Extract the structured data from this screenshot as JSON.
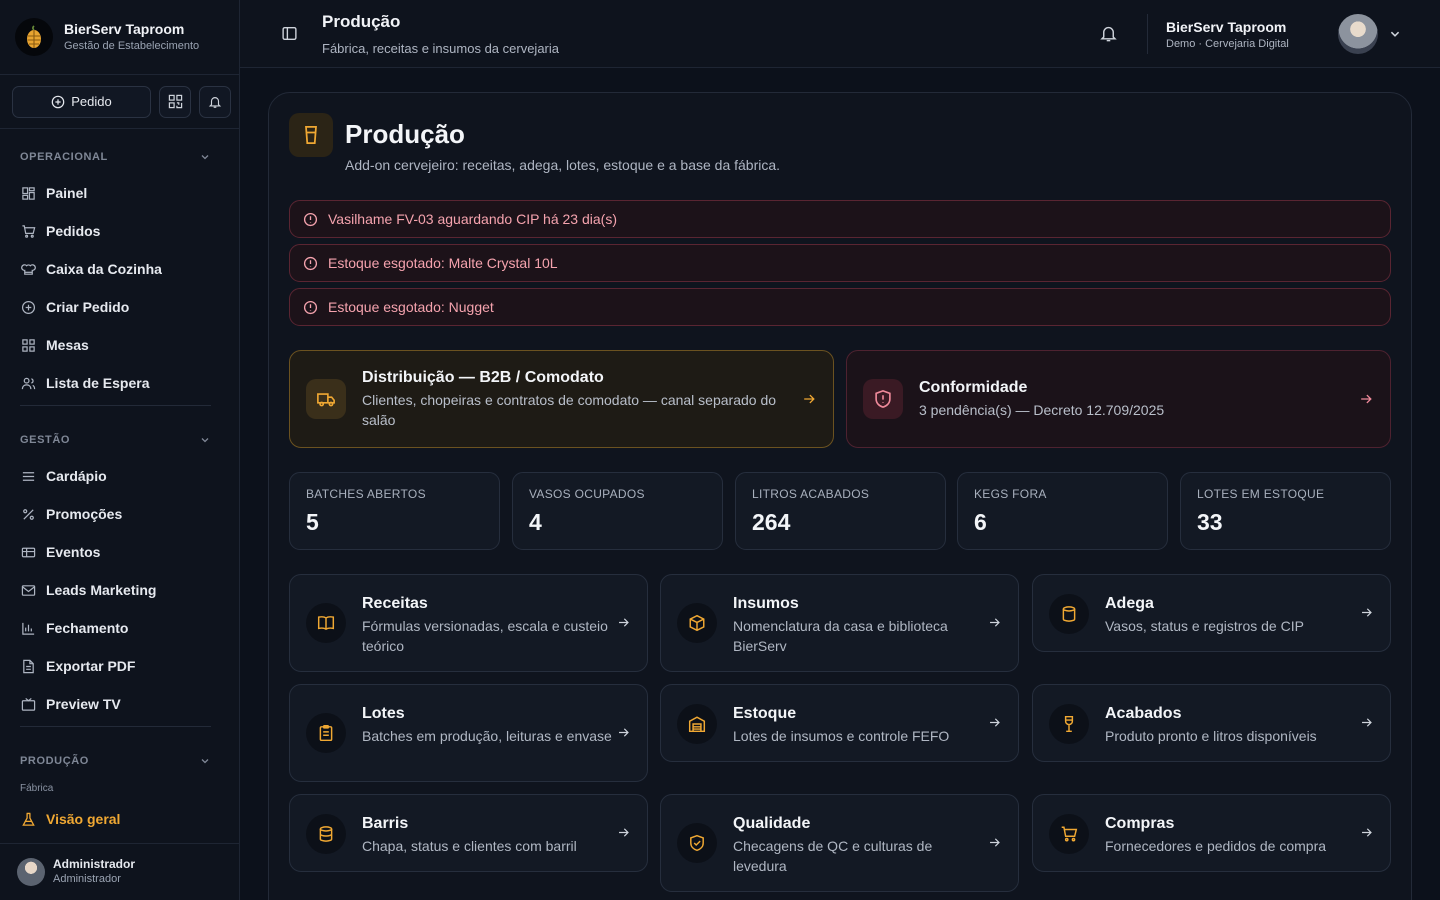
{
  "brand": {
    "name": "BierServ Taproom",
    "subtitle": "Gestão de Estabelecimento"
  },
  "quick_actions": {
    "order_label": "Pedido"
  },
  "sidebar": {
    "sections": [
      {
        "title": "OPERACIONAL",
        "items": [
          "Painel",
          "Pedidos",
          "Caixa da Cozinha",
          "Criar Pedido",
          "Mesas",
          "Lista de Espera"
        ]
      },
      {
        "title": "GESTÃO",
        "items": [
          "Cardápio",
          "Promoções",
          "Eventos",
          "Leads Marketing",
          "Fechamento",
          "Exportar PDF",
          "Preview TV"
        ]
      },
      {
        "title": "PRODUÇÃO",
        "group_label": "Fábrica",
        "items": [
          "Visão geral"
        ]
      }
    ],
    "user": {
      "name": "Administrador",
      "role": "Administrador"
    }
  },
  "topbar": {
    "title": "Produção",
    "subtitle": "Fábrica, receitas e insumos da cervejaria",
    "org_name": "BierServ Taproom",
    "org_sub": "Demo · Cervejaria Digital"
  },
  "page": {
    "title": "Produção",
    "subtitle": "Add-on cervejeiro: receitas, adega, lotes, estoque e a base da fábrica."
  },
  "alerts": [
    "Vasilhame FV-03 aguardando CIP há 23 dia(s)",
    "Estoque esgotado: Malte Crystal 10L",
    "Estoque esgotado: Nugget"
  ],
  "features": {
    "distribution": {
      "title": "Distribuição — B2B / Comodato",
      "desc": "Clientes, chopeiras e contratos de comodato — canal separado do salão"
    },
    "compliance": {
      "title": "Conformidade",
      "desc": "3 pendência(s) — Decreto 12.709/2025"
    }
  },
  "stats": [
    {
      "label": "BATCHES ABERTOS",
      "value": "5"
    },
    {
      "label": "VASOS OCUPADOS",
      "value": "4"
    },
    {
      "label": "LITROS ACABADOS",
      "value": "264"
    },
    {
      "label": "KEGS FORA",
      "value": "6"
    },
    {
      "label": "LOTES EM ESTOQUE",
      "value": "33"
    }
  ],
  "modules": [
    {
      "title": "Receitas",
      "desc": "Fórmulas versionadas, escala e custeio teórico",
      "icon": "book-icon"
    },
    {
      "title": "Insumos",
      "desc": "Nomenclatura da casa e biblioteca BierServ",
      "icon": "box-icon"
    },
    {
      "title": "Adega",
      "desc": "Vasos, status e registros de CIP",
      "icon": "barrel-icon"
    },
    {
      "title": "Lotes",
      "desc": "Batches em produção, leituras e envase",
      "icon": "clipboard-icon"
    },
    {
      "title": "Estoque",
      "desc": "Lotes de insumos e controle FEFO",
      "icon": "warehouse-icon"
    },
    {
      "title": "Acabados",
      "desc": "Produto pronto e litros disponíveis",
      "icon": "wine-icon"
    },
    {
      "title": "Barris",
      "desc": "Chapa, status e clientes com barril",
      "icon": "keg-icon"
    },
    {
      "title": "Qualidade",
      "desc": "Checagens de QC e culturas de levedura",
      "icon": "shield-check-icon"
    },
    {
      "title": "Compras",
      "desc": "Fornecedores e pedidos de compra",
      "icon": "cart-icon"
    }
  ],
  "colors": {
    "accent": "#f0a833",
    "alert_text": "#f5a3ae",
    "background": "#0c111b"
  }
}
